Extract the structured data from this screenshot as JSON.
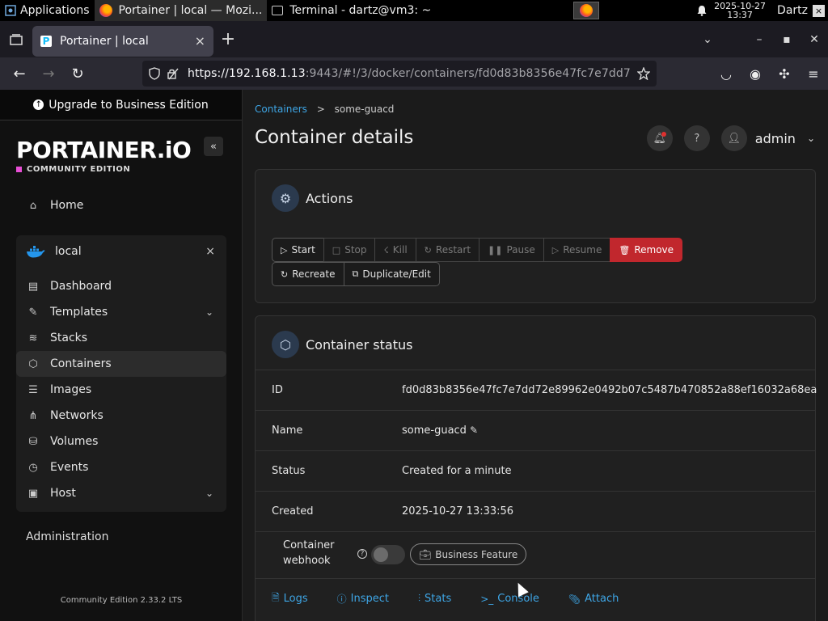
{
  "os_panel": {
    "applications": "Applications",
    "task_firefox": "Portainer | local — Mozi...",
    "task_terminal": "Terminal - dartz@vm3: ~",
    "clock_date": "2025-10-27",
    "clock_time": "13:37",
    "user": "Dartz"
  },
  "browser": {
    "tab_title": "Portainer | local",
    "url_host": "https://192.168.1.13",
    "url_rest": ":9443/#!/3/docker/containers/fd0d83b8356e47fc7e7dd7"
  },
  "sidebar": {
    "upgrade_label": "Upgrade to Business Edition",
    "logo": "PORTAINER.iO",
    "logo_sub": "COMMUNITY EDITION",
    "home": "Home",
    "environment": "local",
    "items": [
      {
        "label": "Dashboard"
      },
      {
        "label": "Templates"
      },
      {
        "label": "Stacks"
      },
      {
        "label": "Containers"
      },
      {
        "label": "Images"
      },
      {
        "label": "Networks"
      },
      {
        "label": "Volumes"
      },
      {
        "label": "Events"
      },
      {
        "label": "Host"
      }
    ],
    "administration": "Administration",
    "version": "Community Edition 2.33.2 LTS"
  },
  "main": {
    "breadcrumb_root": "Containers",
    "breadcrumb_sep": ">",
    "breadcrumb_current": "some-guacd",
    "title": "Container details",
    "user": "admin",
    "actions": {
      "title": "Actions",
      "start": "Start",
      "stop": "Stop",
      "kill": "Kill",
      "restart": "Restart",
      "pause": "Pause",
      "resume": "Resume",
      "remove": "Remove",
      "recreate": "Recreate",
      "duplicate": "Duplicate/Edit"
    },
    "status": {
      "title": "Container status",
      "id_label": "ID",
      "id_value": "fd0d83b8356e47fc7e7dd72e89962e0492b07c5487b470852a88ef16032a68ea",
      "name_label": "Name",
      "name_value": "some-guacd",
      "status_label": "Status",
      "status_value": "Created for a minute",
      "created_label": "Created",
      "created_value": "2025-10-27 13:33:56",
      "webhook_label_1": "Container",
      "webhook_label_2": "webhook",
      "business_feature": "Business Feature",
      "links": {
        "logs": "Logs",
        "inspect": "Inspect",
        "stats": "Stats",
        "console": "Console",
        "attach": "Attach"
      }
    }
  }
}
